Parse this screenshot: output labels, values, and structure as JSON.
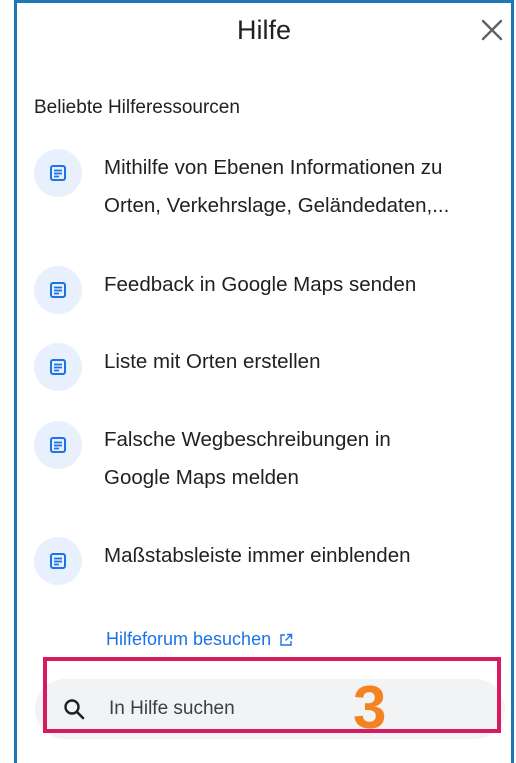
{
  "panel": {
    "title": "Hilfe",
    "close_icon": "close-icon",
    "section_label": "Beliebte Hilferessourcen",
    "items": [
      {
        "label_line1": "Mithilfe von Ebenen Informationen zu",
        "label_line2": "Orten, Verkehrslage, Geländedaten,...",
        "icon": "article-icon"
      },
      {
        "label_line1": "Feedback in Google Maps senden",
        "label_line2": "",
        "icon": "article-icon"
      },
      {
        "label_line1": "Liste mit Orten erstellen",
        "label_line2": "",
        "icon": "article-icon"
      },
      {
        "label_line1": "Falsche Wegbeschreibungen in",
        "label_line2": "Google Maps melden",
        "icon": "article-icon"
      },
      {
        "label_line1": "Maßstabsleiste immer einblenden",
        "label_line2": "",
        "icon": "article-icon"
      }
    ],
    "forum_link": "Hilfeforum besuchen",
    "forum_icon": "open-in-new-icon",
    "search": {
      "placeholder": "In Hilfe suchen",
      "value": "",
      "icon": "search-icon"
    }
  },
  "annotation": {
    "marker": "3",
    "highlight_color": "#d81b60",
    "marker_color": "#f58220"
  },
  "colors": {
    "frame": "#1f77b8",
    "link": "#1a73e8",
    "icon_bg": "#e8f0fe",
    "icon": "#1a73e8"
  }
}
